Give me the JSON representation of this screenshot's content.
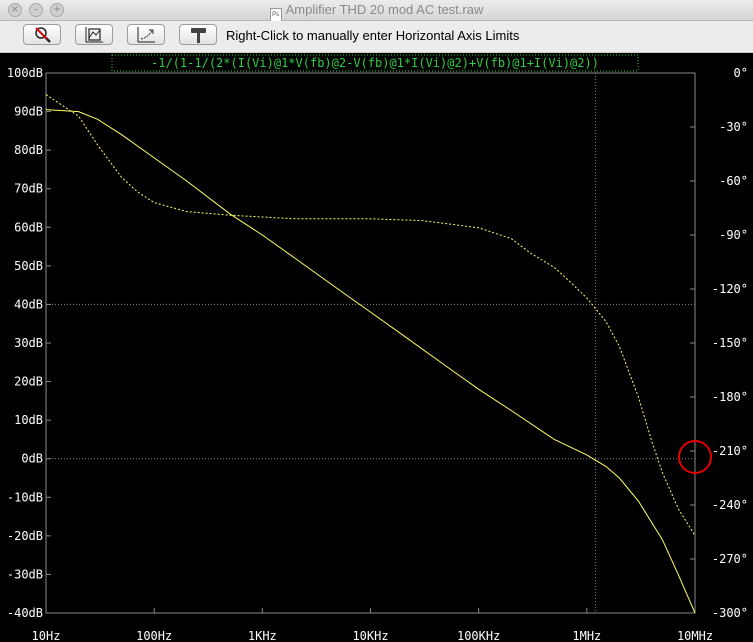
{
  "window": {
    "title": "Amplifier THD 20 mod AC test.raw",
    "doc_icon": "Ps"
  },
  "toolbar": {
    "buttons": [
      {
        "name": "zoom-cancel-button",
        "icon": "magnifier-cross-icon"
      },
      {
        "name": "autorange-button",
        "icon": "autorange-icon"
      },
      {
        "name": "zoom-back-button",
        "icon": "zoom-back-icon"
      },
      {
        "name": "pick-trace-button",
        "icon": "hammer-icon"
      }
    ],
    "hint": "Right-Click to manually enter Horizontal Axis Limits"
  },
  "colors": {
    "background": "#000000",
    "trace": "#ffff66",
    "grid": "#8a8a8a",
    "expression": "#2ecc40",
    "annotation": "#e60000"
  },
  "chart_data": {
    "type": "line",
    "title": "-1/(1-1/(2*(I(Vi)@1*V(fb)@2-V(fb)@1*I(Vi)@2)+V(fb)@1+I(Vi)@2))",
    "x_scale": "log",
    "xlim": [
      10,
      10000000
    ],
    "x_ticks": [
      {
        "value": 10,
        "label": "10Hz"
      },
      {
        "value": 100,
        "label": "100Hz"
      },
      {
        "value": 1000,
        "label": "1KHz"
      },
      {
        "value": 10000,
        "label": "10KHz"
      },
      {
        "value": 100000,
        "label": "100KHz"
      },
      {
        "value": 1000000,
        "label": "1MHz"
      },
      {
        "value": 10000000,
        "label": "10MHz"
      }
    ],
    "ylim_left": [
      -40,
      100
    ],
    "y_left_ticks": [
      {
        "value": 100,
        "label": "100dB"
      },
      {
        "value": 90,
        "label": "90dB"
      },
      {
        "value": 80,
        "label": "80dB"
      },
      {
        "value": 70,
        "label": "70dB"
      },
      {
        "value": 60,
        "label": "60dB"
      },
      {
        "value": 50,
        "label": "50dB"
      },
      {
        "value": 40,
        "label": "40dB"
      },
      {
        "value": 30,
        "label": "30dB"
      },
      {
        "value": 20,
        "label": "20dB"
      },
      {
        "value": 10,
        "label": "10dB"
      },
      {
        "value": 0,
        "label": "0dB"
      },
      {
        "value": -10,
        "label": "-10dB"
      },
      {
        "value": -20,
        "label": "-20dB"
      },
      {
        "value": -30,
        "label": "-30dB"
      },
      {
        "value": -40,
        "label": "-40dB"
      }
    ],
    "ylim_right": [
      -300,
      0
    ],
    "y_right_ticks": [
      {
        "value": 0,
        "label": "0°"
      },
      {
        "value": -30,
        "label": "-30°"
      },
      {
        "value": -60,
        "label": "-60°"
      },
      {
        "value": -90,
        "label": "-90°"
      },
      {
        "value": -120,
        "label": "-120°"
      },
      {
        "value": -150,
        "label": "-150°"
      },
      {
        "value": -180,
        "label": "-180°"
      },
      {
        "value": -210,
        "label": "-210°"
      },
      {
        "value": -240,
        "label": "-240°"
      },
      {
        "value": -270,
        "label": "-270°"
      },
      {
        "value": -300,
        "label": "-300°"
      }
    ],
    "grid_lines": {
      "horizontal_db": [
        40,
        0
      ],
      "vertical_hz": [
        1200000
      ]
    },
    "series": [
      {
        "kind": "magnitude",
        "axis": "left",
        "style": "solid",
        "points": [
          [
            10,
            90.5
          ],
          [
            20,
            90
          ],
          [
            30,
            88
          ],
          [
            50,
            84
          ],
          [
            100,
            78
          ],
          [
            200,
            72
          ],
          [
            500,
            63.5
          ],
          [
            1000,
            58
          ],
          [
            2000,
            52
          ],
          [
            5000,
            44
          ],
          [
            10000,
            38
          ],
          [
            20000,
            32
          ],
          [
            50000,
            24
          ],
          [
            100000,
            18
          ],
          [
            200000,
            12.5
          ],
          [
            500000,
            5
          ],
          [
            1000000,
            1
          ],
          [
            1500000,
            -2
          ],
          [
            2000000,
            -5
          ],
          [
            3000000,
            -11
          ],
          [
            5000000,
            -21
          ],
          [
            7000000,
            -30
          ],
          [
            10000000,
            -40
          ]
        ]
      },
      {
        "kind": "phase",
        "axis": "right",
        "style": "dotted",
        "points": [
          [
            10,
            -12
          ],
          [
            20,
            -24
          ],
          [
            30,
            -40
          ],
          [
            50,
            -58
          ],
          [
            70,
            -66
          ],
          [
            100,
            -72
          ],
          [
            200,
            -77
          ],
          [
            500,
            -79
          ],
          [
            1000,
            -80
          ],
          [
            2000,
            -81
          ],
          [
            5000,
            -81
          ],
          [
            10000,
            -81
          ],
          [
            30000,
            -82
          ],
          [
            100000,
            -86
          ],
          [
            200000,
            -92
          ],
          [
            300000,
            -100
          ],
          [
            500000,
            -108
          ],
          [
            700000,
            -116
          ],
          [
            1000000,
            -125
          ],
          [
            1500000,
            -138
          ],
          [
            2000000,
            -152
          ],
          [
            3000000,
            -180
          ],
          [
            4000000,
            -205
          ],
          [
            5000000,
            -222
          ],
          [
            7000000,
            -242
          ],
          [
            10000000,
            -257
          ]
        ]
      }
    ],
    "annotation": {
      "shape": "circle",
      "near_tick": "-210°"
    }
  }
}
